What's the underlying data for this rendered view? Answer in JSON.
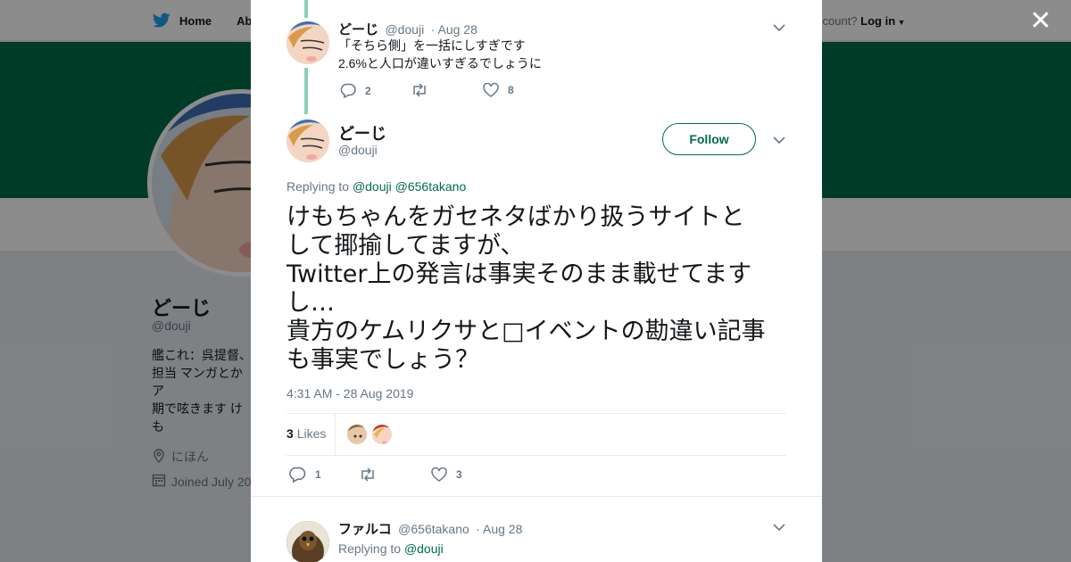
{
  "topbar": {
    "home_label": "Home",
    "about_label": "Abo",
    "account_prompt": "ccount?",
    "login_label": "Log in"
  },
  "profile": {
    "name": "どーじ",
    "handle": "@douji",
    "bio": "艦これ：呉提督、\n担当 マンガとかア\n期で呟きます けも\nです つまりはこれ\nね",
    "location": "にほん",
    "joined": "Joined July 20"
  },
  "thread": {
    "parent": {
      "name": "どーじ",
      "handle": "@douji",
      "date": "· Aug 28",
      "line1": "「そちら側」を一括にしすぎです",
      "line2": "2.6%と人口が違いすぎるでしょうに",
      "replies": "2",
      "retweets": "",
      "likes": "8"
    },
    "main": {
      "name": "どーじ",
      "handle": "@douji",
      "follow_label": "Follow",
      "replying_prefix": "Replying to",
      "mention1": "@douji",
      "mention2": "@656takano",
      "text": "けもちゃんをガセネタばかり扱うサイトと\nして揶揄してますが、\nTwitter上の発言は事実そのまま載せてます\nし…\n貴方のケムリクサと□イベントの勘違い記事\nも事実でしょう？",
      "timestamp": "4:31 AM - 28 Aug 2019",
      "likes_count": "3",
      "likes_label": "Likes",
      "replies": "1",
      "retweets": "",
      "likes": "3"
    },
    "reply": {
      "name": "ファルコ",
      "handle": "@656takano",
      "date": "· Aug 28",
      "replying_prefix": "Replying to",
      "mention": "@douji"
    }
  },
  "colors": {
    "accent": "#006c48",
    "banner": "#006c48",
    "thread_line": "#8dd0b7",
    "muted": "#657786"
  }
}
